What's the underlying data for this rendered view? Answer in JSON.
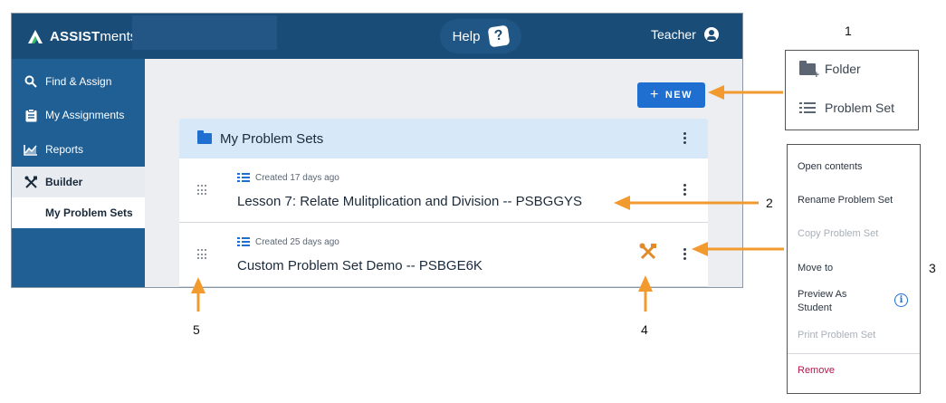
{
  "app": {
    "logo_bold": "ASSIST",
    "logo_light": "ments",
    "help_label": "Help",
    "help_icon_glyph": "?",
    "user_label": "Teacher",
    "sidebar": {
      "find_assign": "Find & Assign",
      "my_assignments": "My Assignments",
      "reports": "Reports",
      "builder": "Builder",
      "my_problem_sets": "My Problem Sets"
    },
    "new_button": "NEW",
    "panel_title": "My Problem Sets",
    "rows": [
      {
        "meta": "Created 17 days ago",
        "title": "Lesson 7: Relate Mulitplication and Division -- PSBGGYS"
      },
      {
        "meta": "Created 25 days ago",
        "title": "Custom Problem Set Demo -- PSBGE6K"
      }
    ]
  },
  "new_menu": {
    "folder": "Folder",
    "problem_set": "Problem Set"
  },
  "context_menu": {
    "open_contents": "Open contents",
    "rename": "Rename Problem Set",
    "copy": "Copy Problem Set",
    "move_to": "Move to",
    "preview_line1": "Preview As",
    "preview_line2": "Student",
    "info_glyph": "i",
    "print": "Print Problem Set",
    "remove": "Remove"
  },
  "callouts": [
    "1",
    "2",
    "3",
    "4",
    "5"
  ],
  "colors": {
    "topbar": "#1a4c78",
    "sidebar": "#1f5f94",
    "accent": "#1f6fd1",
    "arrow": "#f29a2e",
    "wrench": "#e08a28",
    "danger": "#b5174a"
  },
  "icons": [
    "search-icon",
    "clipboard-icon",
    "chart-icon",
    "tools-icon",
    "folder-icon",
    "list-icon",
    "drag-handle-icon",
    "wrench-icon",
    "kebab-icon",
    "user-icon",
    "help-icon",
    "info-icon"
  ]
}
